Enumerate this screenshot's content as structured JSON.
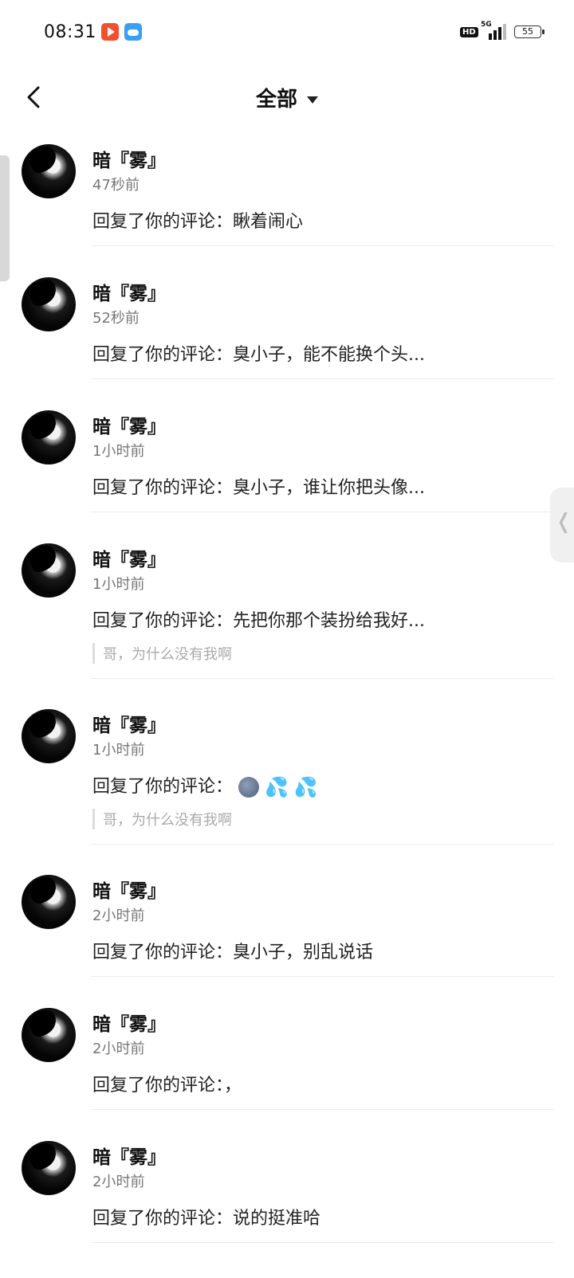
{
  "status_bar": {
    "time": "08:31",
    "hd_label": "HD",
    "network_label": "5G",
    "battery": "55"
  },
  "header": {
    "title": "全部"
  },
  "notifications": [
    {
      "name": "暗『雾』",
      "time": "47秒前",
      "reply": "回复了你的评论：瞅着闹心",
      "quote": ""
    },
    {
      "name": "暗『雾』",
      "time": "52秒前",
      "reply": "回复了你的评论：臭小子，能不能换个头...",
      "quote": ""
    },
    {
      "name": "暗『雾』",
      "time": "1小时前",
      "reply": "回复了你的评论：臭小子，谁让你把头像...",
      "quote": ""
    },
    {
      "name": "暗『雾』",
      "time": "1小时前",
      "reply": "回复了你的评论：先把你那个装扮给我好...",
      "quote": "哥，为什么没有我啊"
    },
    {
      "name": "暗『雾』",
      "time": "1小时前",
      "reply": "回复了你的评论：",
      "quote": "哥，为什么没有我啊",
      "emoji": [
        "moon-face-icon",
        "sweat-droplets-icon",
        "sweat-droplets-icon"
      ]
    },
    {
      "name": "暗『雾』",
      "time": "2小时前",
      "reply": "回复了你的评论：臭小子，别乱说话",
      "quote": ""
    },
    {
      "name": "暗『雾』",
      "time": "2小时前",
      "reply": "回复了你的评论：，",
      "quote": ""
    },
    {
      "name": "暗『雾』",
      "time": "2小时前",
      "reply": "回复了你的评论：说的挺准哈",
      "quote": ""
    }
  ]
}
